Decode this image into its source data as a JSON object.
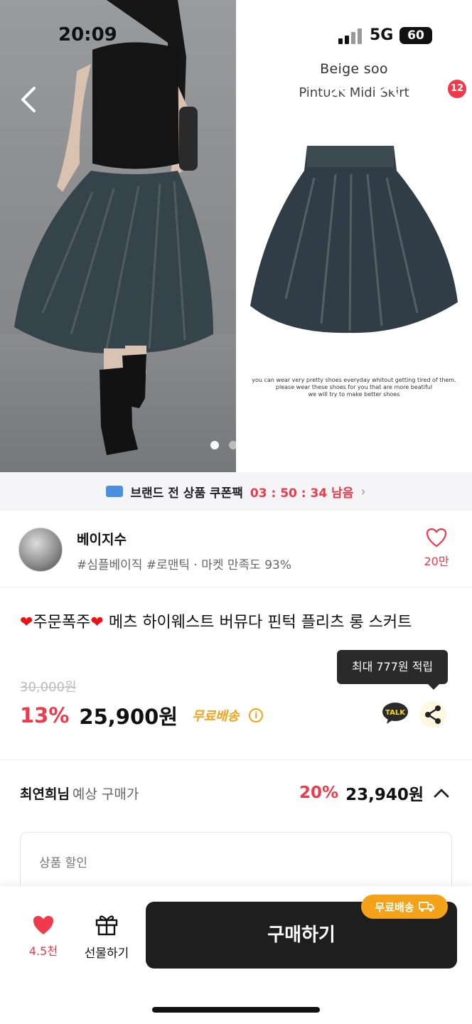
{
  "status_bar": {
    "time": "20:09",
    "network": "5G",
    "battery": "60"
  },
  "hero": {
    "brand_line1": "Beige soo",
    "brand_line2": "Pintuck Midi Skirt",
    "small_caption": [
      "you can wear very pretty shoes everyday whitout getting tired of them.",
      "please wear these shoes for you that are more beatiful",
      "we will try to make better shoes"
    ],
    "cart_count": "12",
    "page_dots": 2
  },
  "coupon": {
    "label": "브랜드 전 상품 쿠폰팩",
    "timer": "03 : 50 : 34 남음"
  },
  "seller": {
    "name": "베이지수",
    "tags": "#심플베이직 #로맨틱 · 마켓 만족도 93%",
    "likes": "20만"
  },
  "product": {
    "title_prefix": "주문폭주",
    "title": "메츠 하이웨스트 버뮤다 핀턱 플리츠 롱 스커트",
    "tooltip": "최대 777원 적립",
    "original_price": "30,000원",
    "discount": "13%",
    "price": "25,900원",
    "shipping": "무료배송",
    "talk_label": "TALK"
  },
  "expected_price": {
    "who": "최연희님",
    "label": "예상 구매가",
    "discount": "20%",
    "price": "23,940원"
  },
  "discount_box": {
    "header": "상품 할인"
  },
  "bottom_bar": {
    "likes": "4.5천",
    "gift_label": "선물하기",
    "buy_label": "구매하기",
    "free_badge": "무료배송"
  },
  "colors": {
    "accent_red": "#ee3a4b",
    "shipping_orange": "#f3a21a",
    "buy_button": "#1e1e1e"
  }
}
